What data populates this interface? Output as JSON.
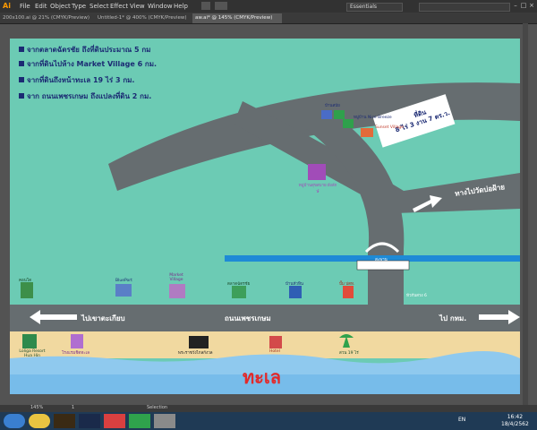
{
  "app": {
    "logo": "Ai",
    "menu": [
      "File",
      "Edit",
      "Object",
      "Type",
      "Select",
      "Effect",
      "View",
      "Window",
      "Help"
    ],
    "workspace": "Essentials",
    "tabs": [
      {
        "label": "200x100.ai @ 21% (CMYK/Preview)"
      },
      {
        "label": "Untitled-1* @ 400% (CMYK/Preview)"
      },
      {
        "label": "aw.ai* @ 145% (CMYK/Preview)"
      }
    ],
    "active_tab": 2,
    "status": {
      "zoom": "145%",
      "page": "1",
      "tool": "Selection"
    }
  },
  "map": {
    "bullets": [
      "จากตลาดฉัตรชัย ถึงที่ดินประมาณ 5 กม",
      "จากที่ดินไปห้าง Market Village 6 กม.",
      "จากที่ดินถึงหน้าทะเล 19 ไร่ 3 กม.",
      "จาก ถนนเพชรเกษม ถึงแปลงที่ดิน 2 กม."
    ],
    "plot": {
      "title": "ที่ดิน",
      "size": "8 ไร่ 3 งาน 7 ตร.ว."
    },
    "village_labels": [
      "บ้านสบัย",
      "หมู่บ้าน Nice Breeze",
      "Sunset Village",
      "หมู่บ้านสุขสบาย ผังลักษ์"
    ],
    "road_right": "ทางไปวัดบ่อฝ้าย",
    "bridge": "สะพาน",
    "junction": "หัวกับสวง 6",
    "road_main": "ถนนเพชรเกษม",
    "road_left": "ไปเขาตะเกียบ",
    "road_right_main": "ไป กทม.",
    "poi_top": [
      "คอนโด",
      "BluePort",
      "Market Village",
      "ตลาดฉัตรชัย",
      "บ้านหัวหิน",
      "ปั๊ม ปตท."
    ],
    "poi_beach": [
      "Loliga Resort Hua Hin",
      "โรงแรมชิดทะเล",
      "พระราชวังไกลกังวล",
      "Hotel",
      "สวน 19 ไร่"
    ],
    "sea": "ทะเล"
  },
  "taskbar": {
    "lang": "EN",
    "time": "16:42",
    "date": "18/4/2562"
  }
}
